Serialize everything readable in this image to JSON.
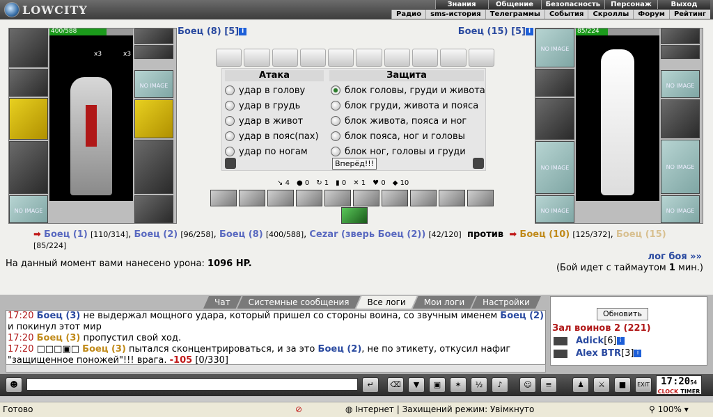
{
  "header": {
    "logo": "LOWCITY",
    "nav_top": [
      "Знания",
      "Общение",
      "Безопасность",
      "Персонаж",
      "Выход"
    ],
    "nav_bottom": [
      "Радио",
      "sms-история",
      "Телеграммы",
      "События",
      "Скроллы",
      "Форум",
      "Рейтинг"
    ]
  },
  "left_player": {
    "hp_text": "400/588",
    "hp_pct": 68,
    "name": "Боец (8)",
    "level": "[5]",
    "counts": [
      "x3",
      "x3"
    ]
  },
  "right_player": {
    "hp_text": "85/224",
    "hp_pct": 38,
    "name": "Боец (15)",
    "level": "[5]"
  },
  "no_image": "NO IMAGE",
  "attack": {
    "header": "Атака",
    "options": [
      "удар в голову",
      "удар в грудь",
      "удар в живот",
      "удар в пояс(пах)",
      "удар по ногам"
    ]
  },
  "defense": {
    "header": "Защита",
    "options": [
      "блок головы, груди и живота",
      "блок груди, живота и пояса",
      "блок живота, пояса и ног",
      "блок пояса, ног и головы",
      "блок ног, головы и груди"
    ]
  },
  "forward_button": "Вперёд!!!",
  "stats": [
    "4",
    "0",
    "1",
    "0",
    "1",
    "0",
    "10"
  ],
  "teams": {
    "left": [
      {
        "name": "Боец (1)",
        "hp": "[110/314]"
      },
      {
        "name": "Боец (2)",
        "hp": "[96/258]"
      },
      {
        "name": "Боец (8)",
        "hp": "[400/588]"
      },
      {
        "name": "Cezar (зверь Боец (2))",
        "hp": "[42/120]"
      }
    ],
    "vs": "против",
    "right": [
      {
        "name": "Боец (10)",
        "hp": "[125/372]"
      },
      {
        "name": "Боец (15)",
        "hp": "[85/224]"
      }
    ]
  },
  "damage": {
    "label": "На данный момент вами нанесено урона:",
    "value": "1096 HP."
  },
  "log_link": "лог боя »»",
  "timeout": {
    "prefix": "(Бой идет с таймаутом",
    "value": "1",
    "suffix": "мин.)"
  },
  "chat_tabs": [
    "Чат",
    "Системные сообщения",
    "Все логи",
    "Мои логи",
    "Настройки"
  ],
  "chat_active_tab": "Все логи",
  "chat_lines": [
    {
      "time": "17:20",
      "name": "Боец (3)",
      "text1": "не выдержал мощного удара, который пришел со стороны воина, со звучным именем",
      "name2": "Боец (2)",
      "text2": "и покинул этот мир"
    },
    {
      "time": "17:20",
      "name": "Боец (3)",
      "text1": "пропустил свой ход.",
      "name2": "",
      "text2": ""
    },
    {
      "time": "17:20",
      "name": "Боец (3)",
      "text1": "пытался сконцентрироваться, и за это",
      "name2": "Боец (2)",
      "text2": ", не по этикету, откусил нафиг"
    },
    {
      "time": "",
      "name": "",
      "text1": "\"защищенное поножей\"!!! врага.",
      "name2": "-105",
      "text2": "[0/330]"
    }
  ],
  "room": {
    "refresh": "Обновить",
    "title": "Зал воинов 2 (221)",
    "users": [
      {
        "name": "Adick",
        "level": "[6]"
      },
      {
        "name": "Alex BTR",
        "level": "[3]"
      }
    ]
  },
  "clock": {
    "time": "17:20",
    "seconds": "54",
    "labels": [
      "CLOCK",
      "TIMER"
    ]
  },
  "exit_label": "EXIT",
  "statusbar": {
    "left": "Готово",
    "zone": "Інтернет | Захищений режим: Увімкнуто",
    "zoom": "100%"
  }
}
